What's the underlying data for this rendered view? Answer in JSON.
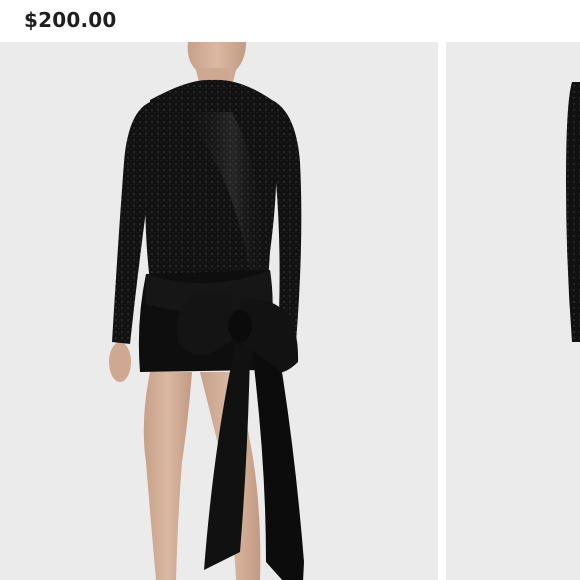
{
  "product": {
    "price": "$200.00"
  },
  "gallery": {
    "images": [
      {
        "icon": "model-photo-front",
        "alt_visible": false
      },
      {
        "icon": "model-photo-side",
        "alt_visible": false
      }
    ]
  },
  "colors": {
    "background": "#ffffff",
    "photo_background": "#ebebeb",
    "garment": "#0d0d0d",
    "price_text": "#1f1f1f"
  }
}
